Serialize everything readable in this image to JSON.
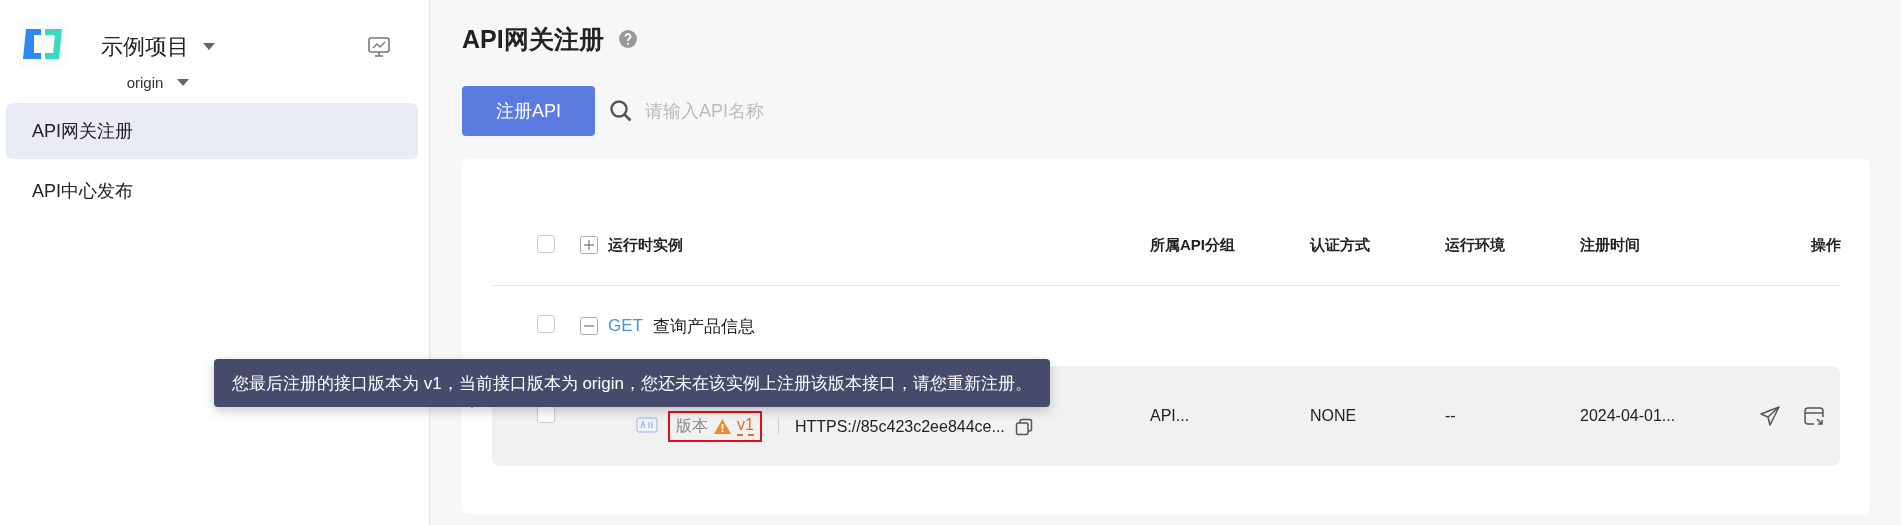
{
  "sidebar": {
    "project": "示例项目",
    "branch": "origin",
    "items": [
      {
        "label": "API网关注册",
        "selected": true
      },
      {
        "label": "API中心发布",
        "selected": false
      }
    ]
  },
  "page": {
    "title": "API网关注册",
    "register_button": "注册API",
    "search": {
      "placeholder": "请输入API名称"
    }
  },
  "table": {
    "select_all": {
      "checked": false
    },
    "expand_all": {
      "expanded": false
    },
    "columns": [
      "运行时实例",
      "所属API分组",
      "认证方式",
      "运行环境",
      "注册时间",
      "操作"
    ],
    "groups": [
      {
        "checked": false,
        "expanded": true,
        "method": "GET",
        "name": "查询产品信息",
        "rows": [
          {
            "checked": false,
            "version_label": "版本",
            "version": "v1",
            "warning": true,
            "url": "HTTPS://85c423c2ee844ce...",
            "group": "API...",
            "auth": "NONE",
            "env": "--",
            "time": "2024-04-01...",
            "tooltip": "您最后注册的接口版本为 v1，当前接口版本为 origin，您还未在该实例上注册该版本接口，请您重新注册。"
          }
        ]
      }
    ]
  }
}
